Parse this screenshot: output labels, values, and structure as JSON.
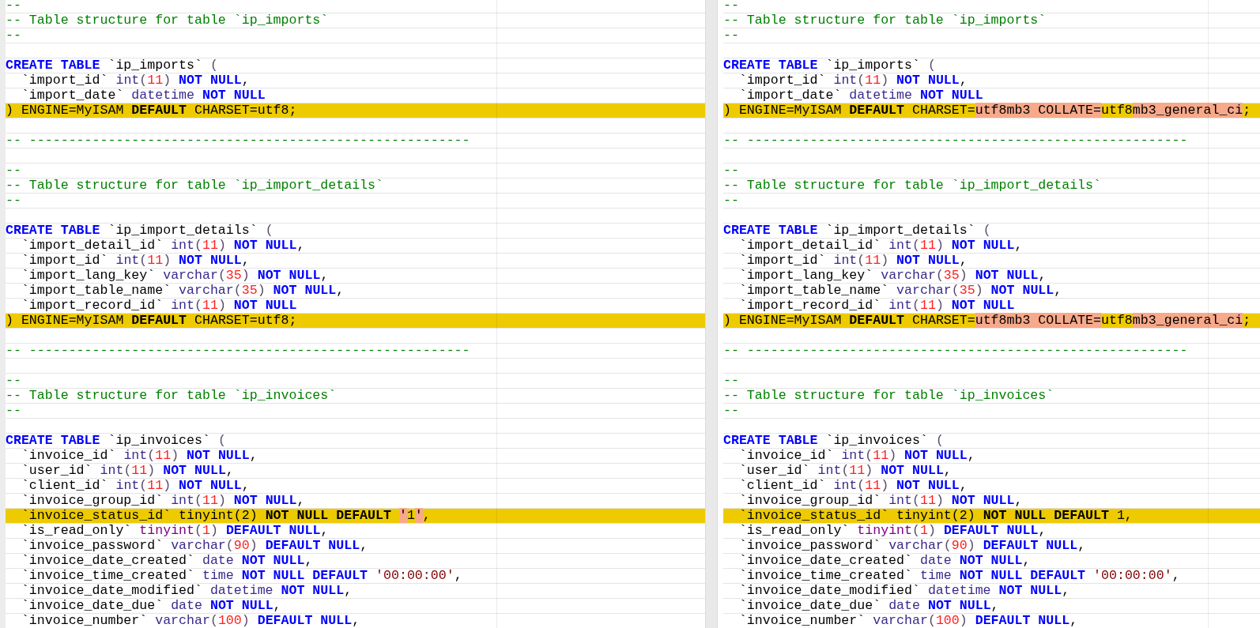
{
  "panes": [
    {
      "lines": [
        {
          "changed": false,
          "tokens": [
            {
              "kind": "comment",
              "text": "--"
            }
          ]
        },
        {
          "changed": false,
          "tokens": [
            {
              "kind": "comment",
              "text": "-- Table structure for table `ip_imports`"
            }
          ]
        },
        {
          "changed": false,
          "tokens": [
            {
              "kind": "comment",
              "text": "--"
            }
          ]
        },
        {
          "changed": false
        },
        {
          "changed": false,
          "tokens": [
            {
              "kind": "keyword",
              "text": "CREATE TABLE"
            },
            {
              "kind": "plain",
              "text": " `ip_imports` "
            },
            {
              "kind": "punct",
              "text": "("
            }
          ]
        },
        {
          "changed": false,
          "tokens": [
            {
              "kind": "plain",
              "text": "  `import_id` "
            },
            {
              "kind": "type",
              "text": "int"
            },
            {
              "kind": "punct",
              "text": "("
            },
            {
              "kind": "number",
              "text": "11"
            },
            {
              "kind": "punct",
              "text": ") "
            },
            {
              "kind": "keyword",
              "text": "NOT NULL"
            },
            {
              "kind": "plain",
              "text": ","
            }
          ]
        },
        {
          "changed": false,
          "tokens": [
            {
              "kind": "plain",
              "text": "  `import_date` "
            },
            {
              "kind": "type",
              "text": "datetime "
            },
            {
              "kind": "keyword",
              "text": "NOT NULL"
            }
          ]
        },
        {
          "changed": true,
          "tokens": [
            {
              "kind": "plain",
              "text": ") ENGINE=MyISAM "
            },
            {
              "kind": "keyword",
              "text": "DEFAULT"
            },
            {
              "kind": "plain",
              "text": " CHARSET=utf8;"
            }
          ]
        },
        {
          "changed": false
        },
        {
          "changed": false,
          "tokens": [
            {
              "kind": "comment",
              "text": "-- --------------------------------------------------------"
            }
          ]
        },
        {
          "changed": false
        },
        {
          "changed": false,
          "tokens": [
            {
              "kind": "comment",
              "text": "--"
            }
          ]
        },
        {
          "changed": false,
          "tokens": [
            {
              "kind": "comment",
              "text": "-- Table structure for table `ip_import_details`"
            }
          ]
        },
        {
          "changed": false,
          "tokens": [
            {
              "kind": "comment",
              "text": "--"
            }
          ]
        },
        {
          "changed": false
        },
        {
          "changed": false,
          "tokens": [
            {
              "kind": "keyword",
              "text": "CREATE TABLE"
            },
            {
              "kind": "plain",
              "text": " `ip_import_details` "
            },
            {
              "kind": "punct",
              "text": "("
            }
          ]
        },
        {
          "changed": false,
          "tokens": [
            {
              "kind": "plain",
              "text": "  `import_detail_id` "
            },
            {
              "kind": "type",
              "text": "int"
            },
            {
              "kind": "punct",
              "text": "("
            },
            {
              "kind": "number",
              "text": "11"
            },
            {
              "kind": "punct",
              "text": ") "
            },
            {
              "kind": "keyword",
              "text": "NOT NULL"
            },
            {
              "kind": "plain",
              "text": ","
            }
          ]
        },
        {
          "changed": false,
          "tokens": [
            {
              "kind": "plain",
              "text": "  `import_id` "
            },
            {
              "kind": "type",
              "text": "int"
            },
            {
              "kind": "punct",
              "text": "("
            },
            {
              "kind": "number",
              "text": "11"
            },
            {
              "kind": "punct",
              "text": ") "
            },
            {
              "kind": "keyword",
              "text": "NOT NULL"
            },
            {
              "kind": "plain",
              "text": ","
            }
          ]
        },
        {
          "changed": false,
          "tokens": [
            {
              "kind": "plain",
              "text": "  `import_lang_key` "
            },
            {
              "kind": "type",
              "text": "varchar"
            },
            {
              "kind": "punct",
              "text": "("
            },
            {
              "kind": "number",
              "text": "35"
            },
            {
              "kind": "punct",
              "text": ") "
            },
            {
              "kind": "keyword",
              "text": "NOT NULL"
            },
            {
              "kind": "plain",
              "text": ","
            }
          ]
        },
        {
          "changed": false,
          "tokens": [
            {
              "kind": "plain",
              "text": "  `import_table_name` "
            },
            {
              "kind": "type",
              "text": "varchar"
            },
            {
              "kind": "punct",
              "text": "("
            },
            {
              "kind": "number",
              "text": "35"
            },
            {
              "kind": "punct",
              "text": ") "
            },
            {
              "kind": "keyword",
              "text": "NOT NULL"
            },
            {
              "kind": "plain",
              "text": ","
            }
          ]
        },
        {
          "changed": false,
          "tokens": [
            {
              "kind": "plain",
              "text": "  `import_record_id` "
            },
            {
              "kind": "type",
              "text": "int"
            },
            {
              "kind": "punct",
              "text": "("
            },
            {
              "kind": "number",
              "text": "11"
            },
            {
              "kind": "punct",
              "text": ") "
            },
            {
              "kind": "keyword",
              "text": "NOT NULL"
            }
          ]
        },
        {
          "changed": true,
          "tokens": [
            {
              "kind": "plain",
              "text": ") ENGINE=MyISAM "
            },
            {
              "kind": "keyword",
              "text": "DEFAULT"
            },
            {
              "kind": "plain",
              "text": " CHARSET=utf8;"
            }
          ]
        },
        {
          "changed": false
        },
        {
          "changed": false,
          "tokens": [
            {
              "kind": "comment",
              "text": "-- --------------------------------------------------------"
            }
          ]
        },
        {
          "changed": false
        },
        {
          "changed": false,
          "tokens": [
            {
              "kind": "comment",
              "text": "--"
            }
          ]
        },
        {
          "changed": false,
          "tokens": [
            {
              "kind": "comment",
              "text": "-- Table structure for table `ip_invoices`"
            }
          ]
        },
        {
          "changed": false,
          "tokens": [
            {
              "kind": "comment",
              "text": "--"
            }
          ]
        },
        {
          "changed": false
        },
        {
          "changed": false,
          "tokens": [
            {
              "kind": "keyword",
              "text": "CREATE TABLE"
            },
            {
              "kind": "plain",
              "text": " `ip_invoices` "
            },
            {
              "kind": "punct",
              "text": "("
            }
          ]
        },
        {
          "changed": false,
          "tokens": [
            {
              "kind": "plain",
              "text": "  `invoice_id` "
            },
            {
              "kind": "type",
              "text": "int"
            },
            {
              "kind": "punct",
              "text": "("
            },
            {
              "kind": "number",
              "text": "11"
            },
            {
              "kind": "punct",
              "text": ") "
            },
            {
              "kind": "keyword",
              "text": "NOT NULL"
            },
            {
              "kind": "plain",
              "text": ","
            }
          ]
        },
        {
          "changed": false,
          "tokens": [
            {
              "kind": "plain",
              "text": "  `user_id` "
            },
            {
              "kind": "type",
              "text": "int"
            },
            {
              "kind": "punct",
              "text": "("
            },
            {
              "kind": "number",
              "text": "11"
            },
            {
              "kind": "punct",
              "text": ") "
            },
            {
              "kind": "keyword",
              "text": "NOT NULL"
            },
            {
              "kind": "plain",
              "text": ","
            }
          ]
        },
        {
          "changed": false,
          "tokens": [
            {
              "kind": "plain",
              "text": "  `client_id` "
            },
            {
              "kind": "type",
              "text": "int"
            },
            {
              "kind": "punct",
              "text": "("
            },
            {
              "kind": "number",
              "text": "11"
            },
            {
              "kind": "punct",
              "text": ") "
            },
            {
              "kind": "keyword",
              "text": "NOT NULL"
            },
            {
              "kind": "plain",
              "text": ","
            }
          ]
        },
        {
          "changed": false,
          "tokens": [
            {
              "kind": "plain",
              "text": "  `invoice_group_id` "
            },
            {
              "kind": "type",
              "text": "int"
            },
            {
              "kind": "punct",
              "text": "("
            },
            {
              "kind": "number",
              "text": "11"
            },
            {
              "kind": "punct",
              "text": ") "
            },
            {
              "kind": "keyword",
              "text": "NOT NULL"
            },
            {
              "kind": "plain",
              "text": ","
            }
          ]
        },
        {
          "changed": true,
          "tokens": [
            {
              "kind": "plain",
              "text": "  `invoice_status_id` tinyint(2) "
            },
            {
              "kind": "keyword",
              "text": "NOT NULL DEFAULT "
            },
            {
              "kind": "diff",
              "text": "'"
            },
            {
              "kind": "plain",
              "text": "1"
            },
            {
              "kind": "diff",
              "text": "'"
            },
            {
              "kind": "plain",
              "text": ","
            }
          ]
        },
        {
          "changed": false,
          "tokens": [
            {
              "kind": "plain",
              "text": "  `is_read_only` "
            },
            {
              "kind": "type2",
              "text": "tinyint"
            },
            {
              "kind": "punct",
              "text": "("
            },
            {
              "kind": "number",
              "text": "1"
            },
            {
              "kind": "punct",
              "text": ") "
            },
            {
              "kind": "keyword",
              "text": "DEFAULT NULL"
            },
            {
              "kind": "plain",
              "text": ","
            }
          ]
        },
        {
          "changed": false,
          "tokens": [
            {
              "kind": "plain",
              "text": "  `invoice_password` "
            },
            {
              "kind": "type",
              "text": "varchar"
            },
            {
              "kind": "punct",
              "text": "("
            },
            {
              "kind": "number",
              "text": "90"
            },
            {
              "kind": "punct",
              "text": ") "
            },
            {
              "kind": "keyword",
              "text": "DEFAULT NULL"
            },
            {
              "kind": "plain",
              "text": ","
            }
          ]
        },
        {
          "changed": false,
          "tokens": [
            {
              "kind": "plain",
              "text": "  `invoice_date_created` "
            },
            {
              "kind": "type",
              "text": "date "
            },
            {
              "kind": "keyword",
              "text": "NOT NULL"
            },
            {
              "kind": "plain",
              "text": ","
            }
          ]
        },
        {
          "changed": false,
          "tokens": [
            {
              "kind": "plain",
              "text": "  `invoice_time_created` "
            },
            {
              "kind": "type",
              "text": "time "
            },
            {
              "kind": "keyword",
              "text": "NOT NULL DEFAULT "
            },
            {
              "kind": "string",
              "text": "'00:00:00'"
            },
            {
              "kind": "plain",
              "text": ","
            }
          ]
        },
        {
          "changed": false,
          "tokens": [
            {
              "kind": "plain",
              "text": "  `invoice_date_modified` "
            },
            {
              "kind": "type",
              "text": "datetime "
            },
            {
              "kind": "keyword",
              "text": "NOT NULL"
            },
            {
              "kind": "plain",
              "text": ","
            }
          ]
        },
        {
          "changed": false,
          "tokens": [
            {
              "kind": "plain",
              "text": "  `invoice_date_due` "
            },
            {
              "kind": "type",
              "text": "date "
            },
            {
              "kind": "keyword",
              "text": "NOT NULL"
            },
            {
              "kind": "plain",
              "text": ","
            }
          ]
        },
        {
          "changed": false,
          "tokens": [
            {
              "kind": "plain",
              "text": "  `invoice_number` "
            },
            {
              "kind": "type",
              "text": "varchar"
            },
            {
              "kind": "punct",
              "text": "("
            },
            {
              "kind": "number",
              "text": "100"
            },
            {
              "kind": "punct",
              "text": ") "
            },
            {
              "kind": "keyword",
              "text": "DEFAULT NULL"
            },
            {
              "kind": "plain",
              "text": ","
            }
          ]
        }
      ]
    },
    {
      "lines": [
        {
          "changed": false,
          "tokens": [
            {
              "kind": "comment",
              "text": "--"
            }
          ]
        },
        {
          "changed": false,
          "tokens": [
            {
              "kind": "comment",
              "text": "-- Table structure for table `ip_imports`"
            }
          ]
        },
        {
          "changed": false,
          "tokens": [
            {
              "kind": "comment",
              "text": "--"
            }
          ]
        },
        {
          "changed": false
        },
        {
          "changed": false,
          "tokens": [
            {
              "kind": "keyword",
              "text": "CREATE TABLE"
            },
            {
              "kind": "plain",
              "text": " `ip_imports` "
            },
            {
              "kind": "punct",
              "text": "("
            }
          ]
        },
        {
          "changed": false,
          "tokens": [
            {
              "kind": "plain",
              "text": "  `import_id` "
            },
            {
              "kind": "type",
              "text": "int"
            },
            {
              "kind": "punct",
              "text": "("
            },
            {
              "kind": "number",
              "text": "11"
            },
            {
              "kind": "punct",
              "text": ") "
            },
            {
              "kind": "keyword",
              "text": "NOT NULL"
            },
            {
              "kind": "plain",
              "text": ","
            }
          ]
        },
        {
          "changed": false,
          "tokens": [
            {
              "kind": "plain",
              "text": "  `import_date` "
            },
            {
              "kind": "type",
              "text": "datetime "
            },
            {
              "kind": "keyword",
              "text": "NOT NULL"
            }
          ]
        },
        {
          "changed": true,
          "tokens": [
            {
              "kind": "plain",
              "text": ") ENGINE=MyISAM "
            },
            {
              "kind": "keyword",
              "text": "DEFAULT"
            },
            {
              "kind": "plain",
              "text": " CHARSET="
            },
            {
              "kind": "diff",
              "text": "utf8mb3 COLLATE="
            },
            {
              "kind": "plain",
              "text": "utf8"
            },
            {
              "kind": "diff",
              "text": "mb3_general_ci"
            },
            {
              "kind": "plain",
              "text": ";"
            }
          ]
        },
        {
          "changed": false
        },
        {
          "changed": false,
          "tokens": [
            {
              "kind": "comment",
              "text": "-- --------------------------------------------------------"
            }
          ]
        },
        {
          "changed": false
        },
        {
          "changed": false,
          "tokens": [
            {
              "kind": "comment",
              "text": "--"
            }
          ]
        },
        {
          "changed": false,
          "tokens": [
            {
              "kind": "comment",
              "text": "-- Table structure for table `ip_import_details`"
            }
          ]
        },
        {
          "changed": false,
          "tokens": [
            {
              "kind": "comment",
              "text": "--"
            }
          ]
        },
        {
          "changed": false
        },
        {
          "changed": false,
          "tokens": [
            {
              "kind": "keyword",
              "text": "CREATE TABLE"
            },
            {
              "kind": "plain",
              "text": " `ip_import_details` "
            },
            {
              "kind": "punct",
              "text": "("
            }
          ]
        },
        {
          "changed": false,
          "tokens": [
            {
              "kind": "plain",
              "text": "  `import_detail_id` "
            },
            {
              "kind": "type",
              "text": "int"
            },
            {
              "kind": "punct",
              "text": "("
            },
            {
              "kind": "number",
              "text": "11"
            },
            {
              "kind": "punct",
              "text": ") "
            },
            {
              "kind": "keyword",
              "text": "NOT NULL"
            },
            {
              "kind": "plain",
              "text": ","
            }
          ]
        },
        {
          "changed": false,
          "tokens": [
            {
              "kind": "plain",
              "text": "  `import_id` "
            },
            {
              "kind": "type",
              "text": "int"
            },
            {
              "kind": "punct",
              "text": "("
            },
            {
              "kind": "number",
              "text": "11"
            },
            {
              "kind": "punct",
              "text": ") "
            },
            {
              "kind": "keyword",
              "text": "NOT NULL"
            },
            {
              "kind": "plain",
              "text": ","
            }
          ]
        },
        {
          "changed": false,
          "tokens": [
            {
              "kind": "plain",
              "text": "  `import_lang_key` "
            },
            {
              "kind": "type",
              "text": "varchar"
            },
            {
              "kind": "punct",
              "text": "("
            },
            {
              "kind": "number",
              "text": "35"
            },
            {
              "kind": "punct",
              "text": ") "
            },
            {
              "kind": "keyword",
              "text": "NOT NULL"
            },
            {
              "kind": "plain",
              "text": ","
            }
          ]
        },
        {
          "changed": false,
          "tokens": [
            {
              "kind": "plain",
              "text": "  `import_table_name` "
            },
            {
              "kind": "type",
              "text": "varchar"
            },
            {
              "kind": "punct",
              "text": "("
            },
            {
              "kind": "number",
              "text": "35"
            },
            {
              "kind": "punct",
              "text": ") "
            },
            {
              "kind": "keyword",
              "text": "NOT NULL"
            },
            {
              "kind": "plain",
              "text": ","
            }
          ]
        },
        {
          "changed": false,
          "tokens": [
            {
              "kind": "plain",
              "text": "  `import_record_id` "
            },
            {
              "kind": "type",
              "text": "int"
            },
            {
              "kind": "punct",
              "text": "("
            },
            {
              "kind": "number",
              "text": "11"
            },
            {
              "kind": "punct",
              "text": ") "
            },
            {
              "kind": "keyword",
              "text": "NOT NULL"
            }
          ]
        },
        {
          "changed": true,
          "tokens": [
            {
              "kind": "plain",
              "text": ") ENGINE=MyISAM "
            },
            {
              "kind": "keyword",
              "text": "DEFAULT"
            },
            {
              "kind": "plain",
              "text": " CHARSET="
            },
            {
              "kind": "diff",
              "text": "utf8mb3 COLLATE="
            },
            {
              "kind": "plain",
              "text": "utf8"
            },
            {
              "kind": "diff",
              "text": "mb3_general_ci"
            },
            {
              "kind": "plain",
              "text": ";"
            }
          ]
        },
        {
          "changed": false
        },
        {
          "changed": false,
          "tokens": [
            {
              "kind": "comment",
              "text": "-- --------------------------------------------------------"
            }
          ]
        },
        {
          "changed": false
        },
        {
          "changed": false,
          "tokens": [
            {
              "kind": "comment",
              "text": "--"
            }
          ]
        },
        {
          "changed": false,
          "tokens": [
            {
              "kind": "comment",
              "text": "-- Table structure for table `ip_invoices`"
            }
          ]
        },
        {
          "changed": false,
          "tokens": [
            {
              "kind": "comment",
              "text": "--"
            }
          ]
        },
        {
          "changed": false
        },
        {
          "changed": false,
          "tokens": [
            {
              "kind": "keyword",
              "text": "CREATE TABLE"
            },
            {
              "kind": "plain",
              "text": " `ip_invoices` "
            },
            {
              "kind": "punct",
              "text": "("
            }
          ]
        },
        {
          "changed": false,
          "tokens": [
            {
              "kind": "plain",
              "text": "  `invoice_id` "
            },
            {
              "kind": "type",
              "text": "int"
            },
            {
              "kind": "punct",
              "text": "("
            },
            {
              "kind": "number",
              "text": "11"
            },
            {
              "kind": "punct",
              "text": ") "
            },
            {
              "kind": "keyword",
              "text": "NOT NULL"
            },
            {
              "kind": "plain",
              "text": ","
            }
          ]
        },
        {
          "changed": false,
          "tokens": [
            {
              "kind": "plain",
              "text": "  `user_id` "
            },
            {
              "kind": "type",
              "text": "int"
            },
            {
              "kind": "punct",
              "text": "("
            },
            {
              "kind": "number",
              "text": "11"
            },
            {
              "kind": "punct",
              "text": ") "
            },
            {
              "kind": "keyword",
              "text": "NOT NULL"
            },
            {
              "kind": "plain",
              "text": ","
            }
          ]
        },
        {
          "changed": false,
          "tokens": [
            {
              "kind": "plain",
              "text": "  `client_id` "
            },
            {
              "kind": "type",
              "text": "int"
            },
            {
              "kind": "punct",
              "text": "("
            },
            {
              "kind": "number",
              "text": "11"
            },
            {
              "kind": "punct",
              "text": ") "
            },
            {
              "kind": "keyword",
              "text": "NOT NULL"
            },
            {
              "kind": "plain",
              "text": ","
            }
          ]
        },
        {
          "changed": false,
          "tokens": [
            {
              "kind": "plain",
              "text": "  `invoice_group_id` "
            },
            {
              "kind": "type",
              "text": "int"
            },
            {
              "kind": "punct",
              "text": "("
            },
            {
              "kind": "number",
              "text": "11"
            },
            {
              "kind": "punct",
              "text": ") "
            },
            {
              "kind": "keyword",
              "text": "NOT NULL"
            },
            {
              "kind": "plain",
              "text": ","
            }
          ]
        },
        {
          "changed": true,
          "tokens": [
            {
              "kind": "plain",
              "text": "  `invoice_status_id` tinyint(2) "
            },
            {
              "kind": "keyword",
              "text": "NOT NULL DEFAULT"
            },
            {
              "kind": "plain",
              "text": " 1,"
            }
          ]
        },
        {
          "changed": false,
          "tokens": [
            {
              "kind": "plain",
              "text": "  `is_read_only` "
            },
            {
              "kind": "type2",
              "text": "tinyint"
            },
            {
              "kind": "punct",
              "text": "("
            },
            {
              "kind": "number",
              "text": "1"
            },
            {
              "kind": "punct",
              "text": ") "
            },
            {
              "kind": "keyword",
              "text": "DEFAULT NULL"
            },
            {
              "kind": "plain",
              "text": ","
            }
          ]
        },
        {
          "changed": false,
          "tokens": [
            {
              "kind": "plain",
              "text": "  `invoice_password` "
            },
            {
              "kind": "type",
              "text": "varchar"
            },
            {
              "kind": "punct",
              "text": "("
            },
            {
              "kind": "number",
              "text": "90"
            },
            {
              "kind": "punct",
              "text": ") "
            },
            {
              "kind": "keyword",
              "text": "DEFAULT NULL"
            },
            {
              "kind": "plain",
              "text": ","
            }
          ]
        },
        {
          "changed": false,
          "tokens": [
            {
              "kind": "plain",
              "text": "  `invoice_date_created` "
            },
            {
              "kind": "type",
              "text": "date "
            },
            {
              "kind": "keyword",
              "text": "NOT NULL"
            },
            {
              "kind": "plain",
              "text": ","
            }
          ]
        },
        {
          "changed": false,
          "tokens": [
            {
              "kind": "plain",
              "text": "  `invoice_time_created` "
            },
            {
              "kind": "type",
              "text": "time "
            },
            {
              "kind": "keyword",
              "text": "NOT NULL DEFAULT "
            },
            {
              "kind": "string",
              "text": "'00:00:00'"
            },
            {
              "kind": "plain",
              "text": ","
            }
          ]
        },
        {
          "changed": false,
          "tokens": [
            {
              "kind": "plain",
              "text": "  `invoice_date_modified` "
            },
            {
              "kind": "type",
              "text": "datetime "
            },
            {
              "kind": "keyword",
              "text": "NOT NULL"
            },
            {
              "kind": "plain",
              "text": ","
            }
          ]
        },
        {
          "changed": false,
          "tokens": [
            {
              "kind": "plain",
              "text": "  `invoice_date_due` "
            },
            {
              "kind": "type",
              "text": "date "
            },
            {
              "kind": "keyword",
              "text": "NOT NULL"
            },
            {
              "kind": "plain",
              "text": ","
            }
          ]
        },
        {
          "changed": false,
          "tokens": [
            {
              "kind": "plain",
              "text": "  `invoice_number` "
            },
            {
              "kind": "type",
              "text": "varchar"
            },
            {
              "kind": "punct",
              "text": "("
            },
            {
              "kind": "number",
              "text": "100"
            },
            {
              "kind": "punct",
              "text": ") "
            },
            {
              "kind": "keyword",
              "text": "DEFAULT NULL"
            },
            {
              "kind": "plain",
              "text": ","
            }
          ]
        }
      ]
    }
  ]
}
